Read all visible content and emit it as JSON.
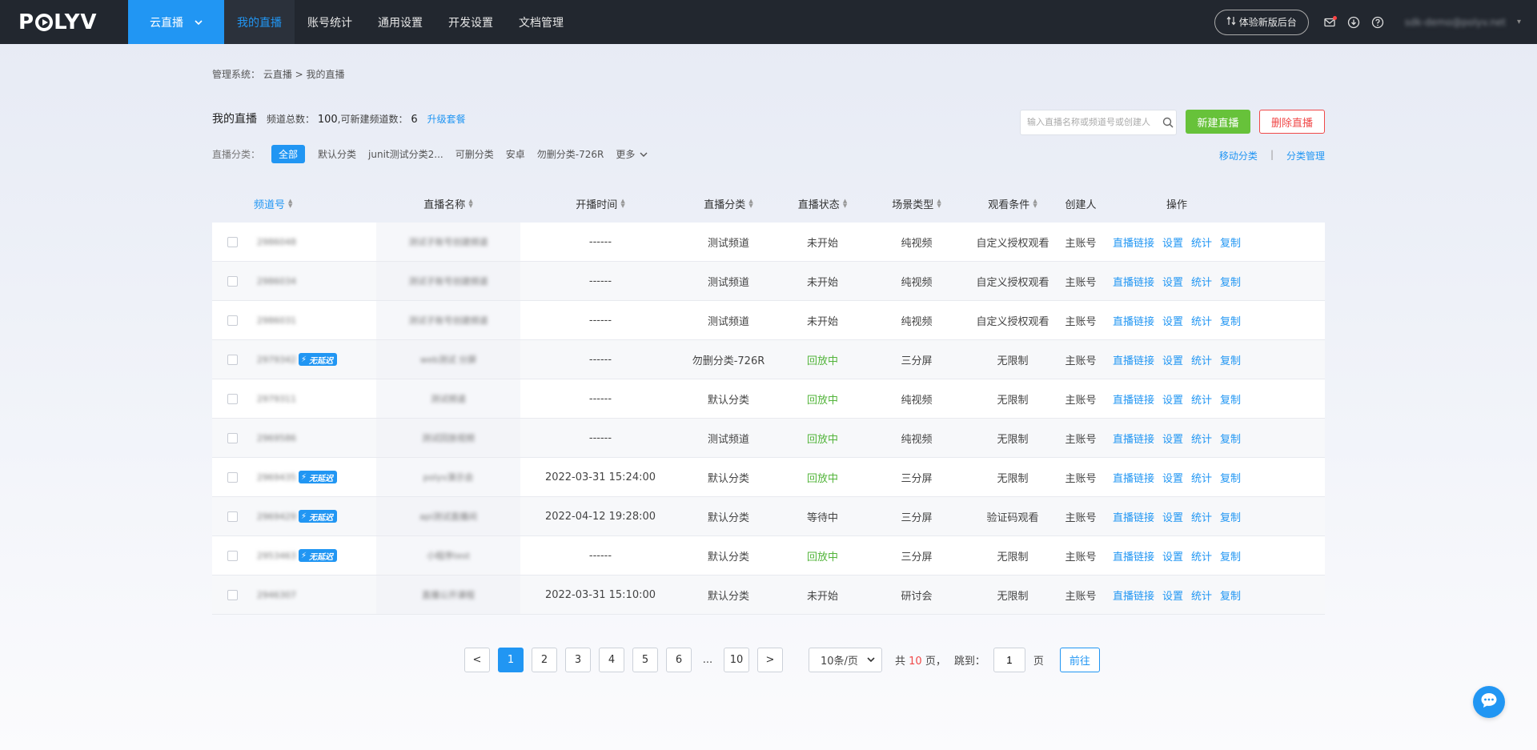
{
  "brand": "POLYV",
  "product_switch": "云直播",
  "nav": [
    {
      "label": "我的直播",
      "active": true
    },
    {
      "label": "账号统计",
      "active": false
    },
    {
      "label": "通用设置",
      "active": false
    },
    {
      "label": "开发设置",
      "active": false
    },
    {
      "label": "文档管理",
      "active": false
    }
  ],
  "topbar": {
    "experience_button": "体验新版后台",
    "user_email": "sdk-demo@polyv.net",
    "icons": [
      "mail-icon",
      "download-icon",
      "help-icon"
    ]
  },
  "breadcrumb": "管理系统：  云直播 > 我的直播",
  "header": {
    "title": "我的直播",
    "total_label": "频道总数：",
    "total_value": "100",
    "creatable_label": ",可新建频道数：",
    "creatable_value": "6",
    "upgrade_link": "升级套餐"
  },
  "search": {
    "placeholder": "输入直播名称或频道号或创建人"
  },
  "actions": {
    "new_live": "新建直播",
    "delete_live": "删除直播"
  },
  "categories": {
    "label": "直播分类：",
    "items": [
      "全部",
      "默认分类",
      "junit测试分类2...",
      "可删分类",
      "安卓",
      "勿删分类-726R"
    ],
    "active": "全部",
    "more": "更多",
    "move": "移动分类",
    "manage": "分类管理"
  },
  "table": {
    "columns": [
      {
        "label": "频道号",
        "sortable": true,
        "active": true
      },
      {
        "label": "直播名称",
        "sortable": true
      },
      {
        "label": "开播时间",
        "sortable": true
      },
      {
        "label": "直播分类",
        "sortable": true
      },
      {
        "label": "直播状态",
        "sortable": true
      },
      {
        "label": "场景类型",
        "sortable": true
      },
      {
        "label": "观看条件",
        "sortable": true
      },
      {
        "label": "创建人",
        "sortable": false
      },
      {
        "label": "操作",
        "sortable": false
      }
    ],
    "low_latency_badge": "无延迟",
    "ops": [
      "直播链接",
      "设置",
      "统计",
      "复制"
    ],
    "rows": [
      {
        "id": "2986048",
        "name": "测试子账号创建频道",
        "time": "------",
        "category": "测试频道",
        "status": "未开始",
        "status_color": "#444444",
        "scene": "纯视频",
        "watch": "自定义授权观看",
        "creator": "主账号",
        "low_latency": false
      },
      {
        "id": "2986034",
        "name": "测试子账号创建频道",
        "time": "------",
        "category": "测试频道",
        "status": "未开始",
        "status_color": "#444444",
        "scene": "纯视频",
        "watch": "自定义授权观看",
        "creator": "主账号",
        "low_latency": false
      },
      {
        "id": "2986031",
        "name": "测试子账号创建频道",
        "time": "------",
        "category": "测试频道",
        "status": "未开始",
        "status_color": "#444444",
        "scene": "纯视频",
        "watch": "自定义授权观看",
        "creator": "主账号",
        "low_latency": false
      },
      {
        "id": "2979342",
        "name": "web测试 分屏",
        "time": "------",
        "category": "勿删分类-726R",
        "status": "回放中",
        "status_color": "#52b43a",
        "scene": "三分屏",
        "watch": "无限制",
        "creator": "主账号",
        "low_latency": true
      },
      {
        "id": "2979311",
        "name": "测试频道",
        "time": "------",
        "category": "默认分类",
        "status": "回放中",
        "status_color": "#52b43a",
        "scene": "纯视频",
        "watch": "无限制",
        "creator": "主账号",
        "low_latency": false
      },
      {
        "id": "2969586",
        "name": "测试回放视频",
        "time": "------",
        "category": "测试频道",
        "status": "回放中",
        "status_color": "#52b43a",
        "scene": "纯视频",
        "watch": "无限制",
        "creator": "主账号",
        "low_latency": false
      },
      {
        "id": "2969435",
        "name": "polyv演示会",
        "time": "2022-03-31 15:24:00",
        "category": "默认分类",
        "status": "回放中",
        "status_color": "#52b43a",
        "scene": "三分屏",
        "watch": "无限制",
        "creator": "主账号",
        "low_latency": true
      },
      {
        "id": "2969429",
        "name": "api测试直播间",
        "time": "2022-04-12 19:28:00",
        "category": "默认分类",
        "status": "等待中",
        "status_color": "#444444",
        "scene": "三分屏",
        "watch": "验证码观看",
        "creator": "主账号",
        "low_latency": true
      },
      {
        "id": "2953463",
        "name": "小程序test",
        "time": "------",
        "category": "默认分类",
        "status": "回放中",
        "status_color": "#52b43a",
        "scene": "三分屏",
        "watch": "无限制",
        "creator": "主账号",
        "low_latency": true
      },
      {
        "id": "2946307",
        "name": "直播公开课程",
        "time": "2022-03-31 15:10:00",
        "category": "默认分类",
        "status": "未开始",
        "status_color": "#444444",
        "scene": "研讨会",
        "watch": "无限制",
        "creator": "主账号",
        "low_latency": false
      }
    ]
  },
  "pagination": {
    "prev": "<",
    "pages": [
      "1",
      "2",
      "3",
      "4",
      "5",
      "6"
    ],
    "ellipsis": "...",
    "last": "10",
    "next": ">",
    "current": "1",
    "page_size": "10条/页",
    "total_prefix": "共",
    "total_pages": "10",
    "total_suffix": "页，",
    "jump_label": "跳到：",
    "jump_value": "1",
    "jump_suffix": "页",
    "go": "前往"
  }
}
